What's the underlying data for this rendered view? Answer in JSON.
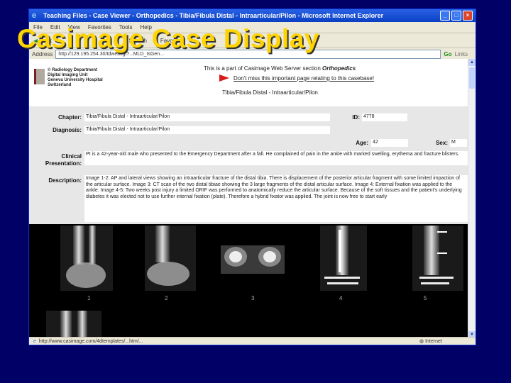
{
  "slide": {
    "title": "Casimage Case Display"
  },
  "window": {
    "title": "Teaching Files - Case Viewer - Orthopedics - Tibia/Fibula Distal - Intraarticular/Pilon - Microsoft Internet Explorer",
    "controls": {
      "minimize": "_",
      "maximize": "□",
      "close": "×"
    }
  },
  "menu": [
    "File",
    "Edit",
    "View",
    "Favorites",
    "Tools",
    "Help"
  ],
  "toolbar": {
    "back": "Back",
    "search": "Search",
    "favorites": "Favorites"
  },
  "address": {
    "label": "Address",
    "url": "http://129.195.254.30/tdwebcgi?...MLD_IsGen...",
    "go": "Go",
    "links": "Links"
  },
  "header": {
    "unit_lines": [
      "© Radiology Department",
      "Digital Imaging Unit",
      "Geneva University Hospital",
      "Switzerland"
    ],
    "intro": "This is a part of Casimage Web Server section ",
    "specialty": "Orthopedics",
    "dont_miss": "Don't miss this important page relating to this casebase!",
    "subtitle": "Tibia/Fibula Distal - Intraarticular/Pilon"
  },
  "case": {
    "chapter_label": "Chapter:",
    "chapter": "Tibia/Fibula Distal - Intraarticular/Pilon",
    "id_label": "ID:",
    "id": "4778",
    "diagnosis_label": "Diagnosis:",
    "diagnosis": "Tibia/Fibula Distal - Intraarticular/Pilon",
    "age_label": "Age:",
    "age": "42",
    "sex_label": "Sex:",
    "sex": "M",
    "clinical_label": "Clinical Presentation:",
    "clinical": "Pt is a 42-year-old male who presented to the Emergency Department after a fall. He complained of pain in the ankle with marked swelling, erythema and fracture blisters.",
    "description_label": "Description:",
    "description": "Image 1-2: AP and lateral views showing an intraarticular fracture of the distal tibia. There is displacement of the posterior articular fragment with some limited impaction of the articular surface. Image 3: CT scan of the two distal tibiae showing the 3 large fragments of the distal articular surface. Image 4: External fixation was applied to the ankle. Image 4-5: Two weeks post injury a limited ORIF was performed to anatomically reduce the articular surface. Because of the soft tissues and the patient's underlying diabetes it was elected not to use further internal fixation (plate). Therefore a hybrid fixator was applied. The joint is now free to start early"
  },
  "images": [
    "1",
    "2",
    "3",
    "4",
    "5"
  ],
  "status": {
    "url": "http://www.casimage.com/4dtemplates/...htm/...",
    "zone": "Internet"
  }
}
